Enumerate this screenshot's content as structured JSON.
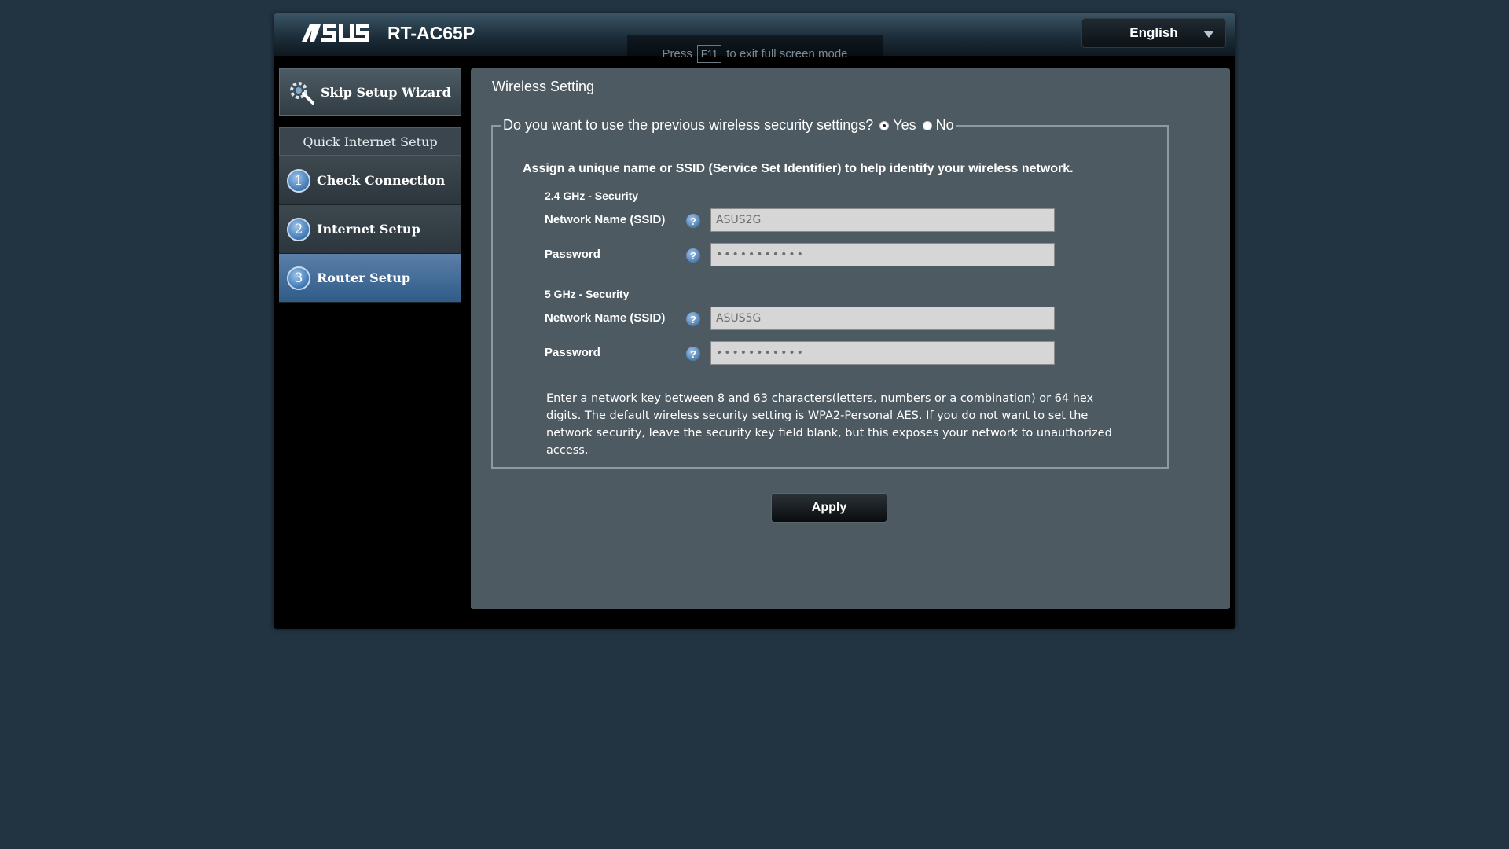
{
  "header": {
    "brand": "ASUS",
    "model": "RT-AC65P",
    "f11_notice": {
      "pre": "Press",
      "key": "F11",
      "post": "to exit full screen mode"
    },
    "language": "English"
  },
  "sidebar": {
    "skip_label": "Skip Setup Wizard",
    "section_title": "Quick Internet Setup",
    "steps": [
      {
        "num": "1",
        "label": "Check Connection"
      },
      {
        "num": "2",
        "label": "Internet Setup"
      },
      {
        "num": "3",
        "label": "Router Setup"
      }
    ]
  },
  "main": {
    "title": "Wireless Setting",
    "question": "Do you want to use the previous wireless security settings?",
    "options": {
      "yes": "Yes",
      "no": "No",
      "selected": "yes"
    },
    "intro": "Assign a unique name or SSID (Service Set Identifier) to help identify your wireless network.",
    "band24": {
      "title": "2.4 GHz - Security",
      "ssid_label": "Network Name (SSID)",
      "ssid_value": "ASUS2G",
      "password_label": "Password",
      "password_value": "•••••••••••"
    },
    "band5": {
      "title": "5 GHz - Security",
      "ssid_label": "Network Name (SSID)",
      "ssid_value": "ASUS5G",
      "password_label": "Password",
      "password_value": "•••••••••••"
    },
    "help_glyph": "?",
    "note": "Enter a network key between 8 and 63 characters(letters, numbers or a combination) or 64 hex digits. The default wireless security setting is WPA2-Personal AES. If you do not want to set the network security, leave the security key field blank, but this exposes your network to unauthorized access.",
    "apply_label": "Apply"
  }
}
